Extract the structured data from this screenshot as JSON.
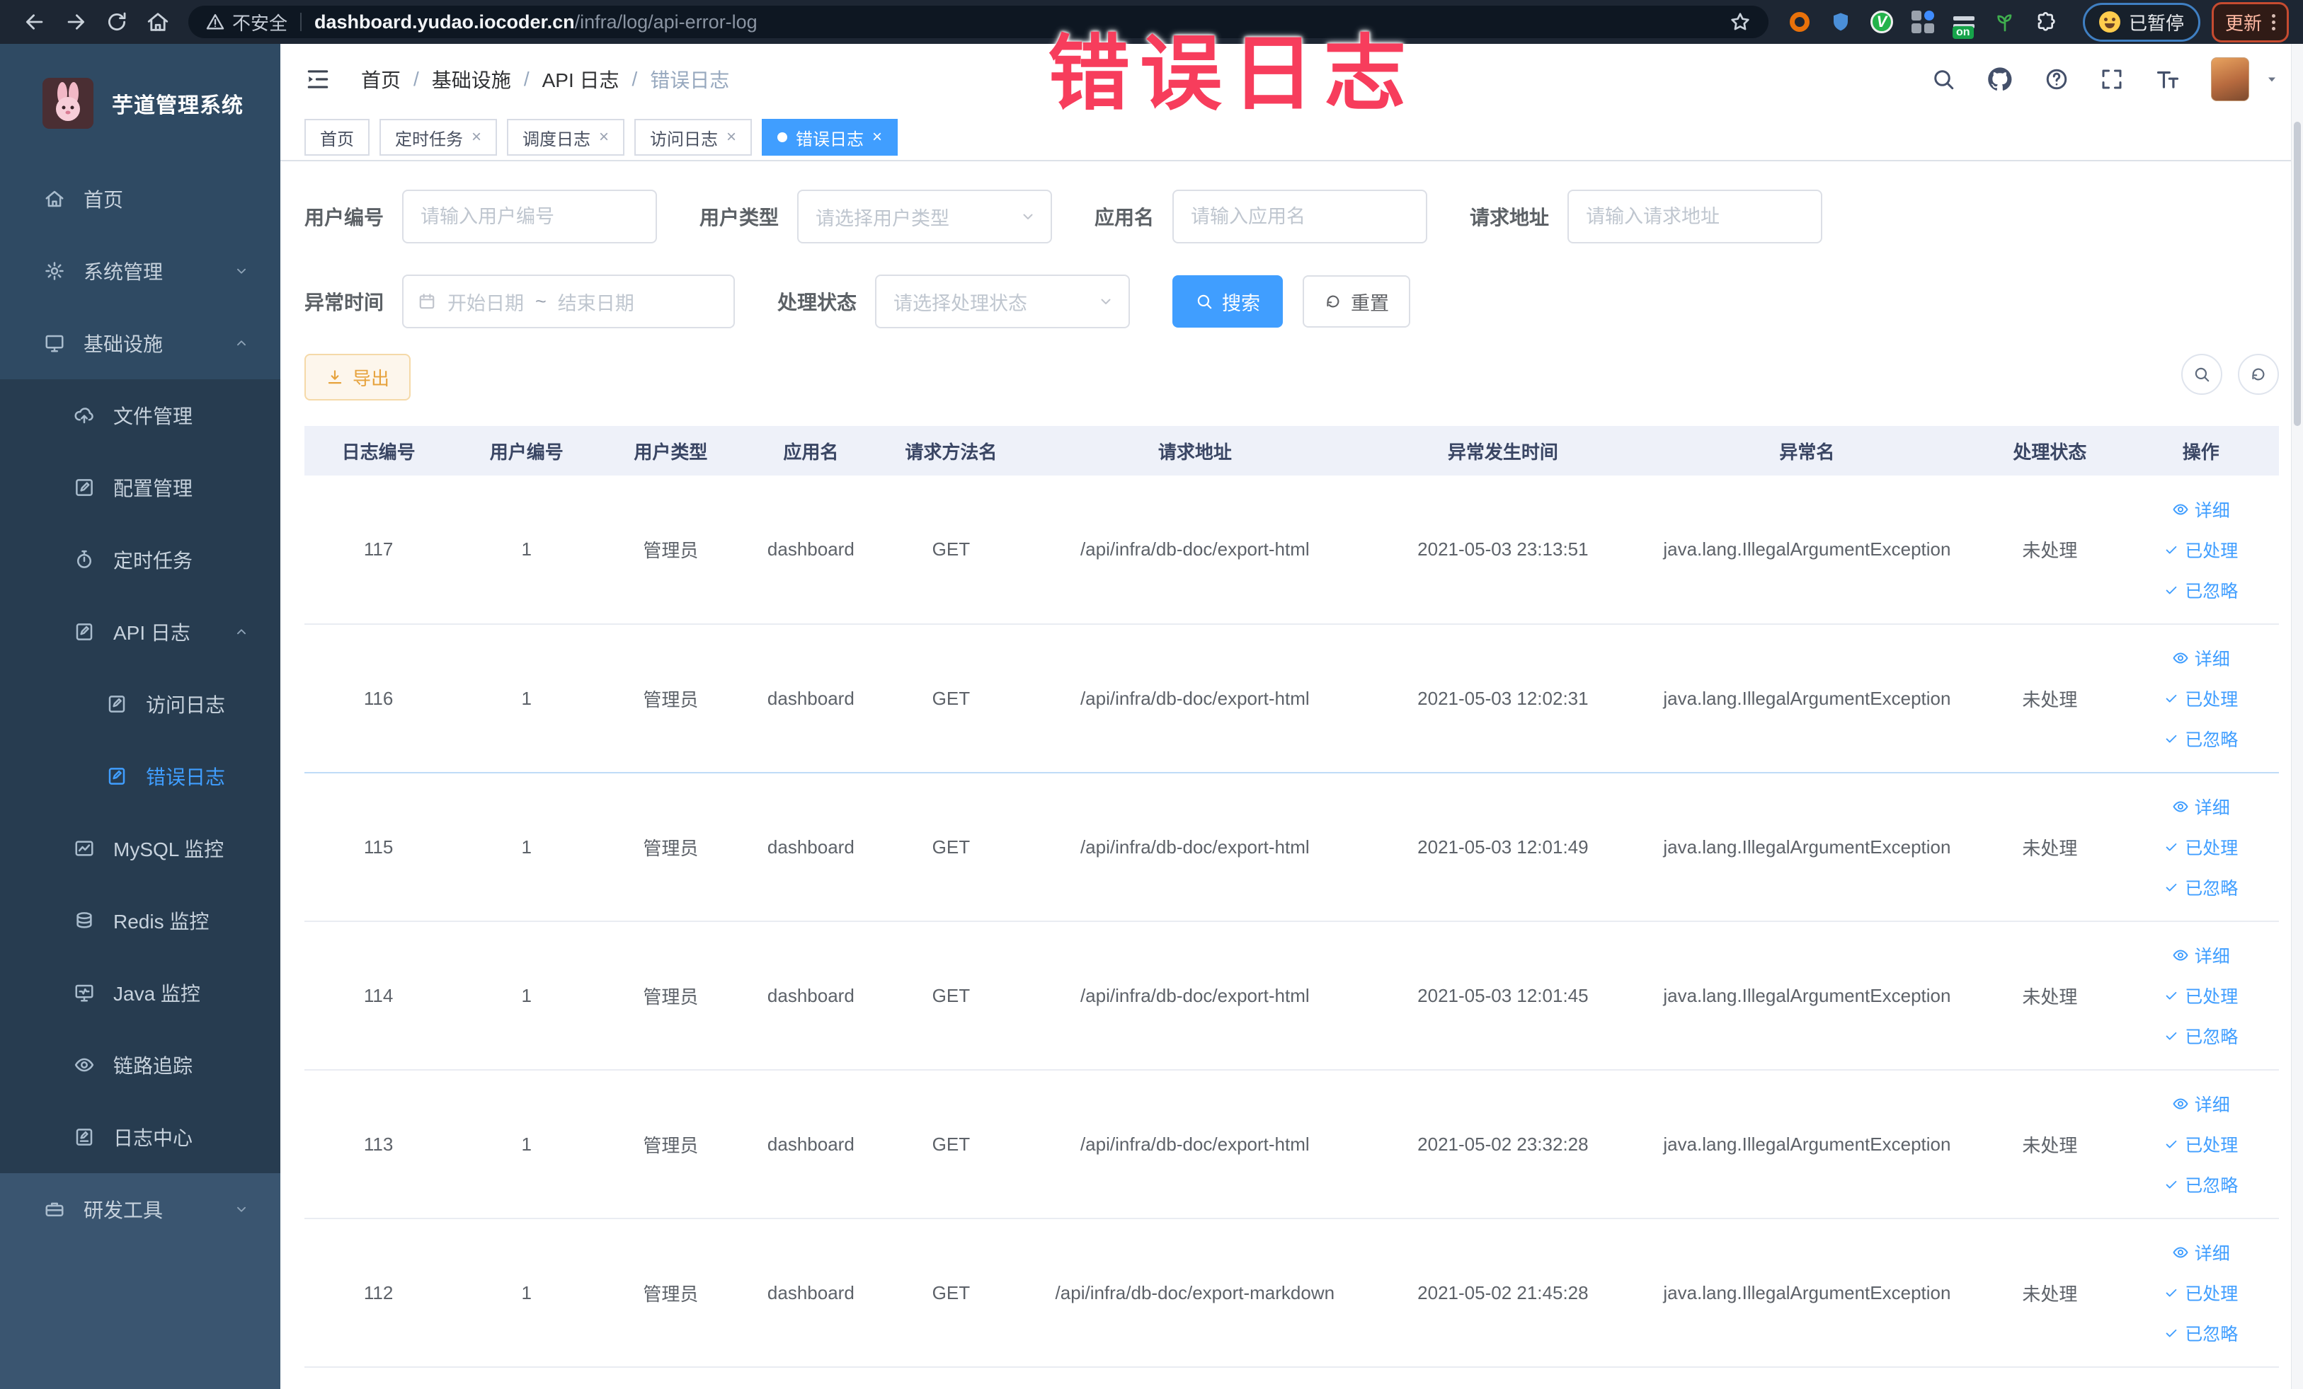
{
  "annotation": {
    "text": "错误日志"
  },
  "browser": {
    "security_label": "不安全",
    "url_host": "dashboard.yudao.iocoder.cn",
    "url_path": "/infra/log/api-error-log",
    "extension_on_badge": "on",
    "paused_pill": "已暂停",
    "update_button": "更新"
  },
  "sidebar": {
    "app_title": "芋道管理系统",
    "items": [
      {
        "label": "首页",
        "icon": "home-icon",
        "level": 1,
        "section": "top"
      },
      {
        "label": "系统管理",
        "icon": "gear-icon",
        "level": 1,
        "section": "top",
        "chevron": "down"
      },
      {
        "label": "基础设施",
        "icon": "monitor-icon",
        "level": 1,
        "section": "top",
        "chevron": "up"
      },
      {
        "label": "文件管理",
        "icon": "cloud-upload-icon",
        "level": 2,
        "section": "sub"
      },
      {
        "label": "配置管理",
        "icon": "edit-square-icon",
        "level": 2,
        "section": "sub"
      },
      {
        "label": "定时任务",
        "icon": "timer-icon",
        "level": 2,
        "section": "sub"
      },
      {
        "label": "API 日志",
        "icon": "api-log-icon",
        "level": 2,
        "section": "sub",
        "chevron": "up"
      },
      {
        "label": "访问日志",
        "icon": "access-log-icon",
        "level": 3,
        "section": "sub"
      },
      {
        "label": "错误日志",
        "icon": "error-log-icon",
        "level": 3,
        "section": "sub",
        "active": true
      },
      {
        "label": "MySQL 监控",
        "icon": "mysql-icon",
        "level": 2,
        "section": "sub"
      },
      {
        "label": "Redis 监控",
        "icon": "redis-icon",
        "level": 2,
        "section": "sub"
      },
      {
        "label": "Java 监控",
        "icon": "java-icon",
        "level": 2,
        "section": "sub"
      },
      {
        "label": "链路追踪",
        "icon": "trace-eye-icon",
        "level": 2,
        "section": "sub"
      },
      {
        "label": "日志中心",
        "icon": "log-center-icon",
        "level": 2,
        "section": "sub"
      },
      {
        "label": "研发工具",
        "icon": "toolbox-icon",
        "level": 1,
        "section": "bottom",
        "chevron": "down"
      }
    ]
  },
  "topbar": {
    "breadcrumb": [
      "首页",
      "基础设施",
      "API 日志",
      "错误日志"
    ]
  },
  "tabs": [
    {
      "label": "首页",
      "closable": false,
      "active": false
    },
    {
      "label": "定时任务",
      "closable": true,
      "active": false
    },
    {
      "label": "调度日志",
      "closable": true,
      "active": false
    },
    {
      "label": "访问日志",
      "closable": true,
      "active": false
    },
    {
      "label": "错误日志",
      "closable": true,
      "active": true
    }
  ],
  "filters": {
    "user_id": {
      "label": "用户编号",
      "placeholder": "请输入用户编号"
    },
    "user_type": {
      "label": "用户类型",
      "placeholder": "请选择用户类型"
    },
    "app_name": {
      "label": "应用名",
      "placeholder": "请输入应用名"
    },
    "request_url": {
      "label": "请求地址",
      "placeholder": "请输入请求地址"
    },
    "exception_time": {
      "label": "异常时间",
      "start_placeholder": "开始日期",
      "separator": "~",
      "end_placeholder": "结束日期"
    },
    "process_status": {
      "label": "处理状态",
      "placeholder": "请选择处理状态"
    },
    "search_button": "搜索",
    "reset_button": "重置"
  },
  "toolbar": {
    "export_button": "导出"
  },
  "table": {
    "columns": [
      "日志编号",
      "用户编号",
      "用户类型",
      "应用名",
      "请求方法名",
      "请求地址",
      "异常发生时间",
      "异常名",
      "处理状态",
      "操作"
    ],
    "action_labels": {
      "detail": "详细",
      "processed": "已处理",
      "ignored": "已忽略"
    },
    "rows": [
      {
        "id": "117",
        "user_id": "1",
        "user_type": "管理员",
        "app": "dashboard",
        "method": "GET",
        "url": "/api/infra/db-doc/export-html",
        "time": "2021-05-03 23:13:51",
        "exception": "java.lang.IllegalArgumentException",
        "status": "未处理"
      },
      {
        "id": "116",
        "user_id": "1",
        "user_type": "管理员",
        "app": "dashboard",
        "method": "GET",
        "url": "/api/infra/db-doc/export-html",
        "time": "2021-05-03 12:02:31",
        "exception": "java.lang.IllegalArgumentException",
        "status": "未处理"
      },
      {
        "id": "115",
        "user_id": "1",
        "user_type": "管理员",
        "app": "dashboard",
        "method": "GET",
        "url": "/api/infra/db-doc/export-html",
        "time": "2021-05-03 12:01:49",
        "exception": "java.lang.IllegalArgumentException",
        "status": "未处理"
      },
      {
        "id": "114",
        "user_id": "1",
        "user_type": "管理员",
        "app": "dashboard",
        "method": "GET",
        "url": "/api/infra/db-doc/export-html",
        "time": "2021-05-03 12:01:45",
        "exception": "java.lang.IllegalArgumentException",
        "status": "未处理"
      },
      {
        "id": "113",
        "user_id": "1",
        "user_type": "管理员",
        "app": "dashboard",
        "method": "GET",
        "url": "/api/infra/db-doc/export-html",
        "time": "2021-05-02 23:32:28",
        "exception": "java.lang.IllegalArgumentException",
        "status": "未处理"
      },
      {
        "id": "112",
        "user_id": "1",
        "user_type": "管理员",
        "app": "dashboard",
        "method": "GET",
        "url": "/api/infra/db-doc/export-markdown",
        "time": "2021-05-02 21:45:28",
        "exception": "java.lang.IllegalArgumentException",
        "status": "未处理"
      }
    ]
  },
  "colors": {
    "accent": "#409EFF",
    "annotation": "#F73D5C",
    "export_accent": "#E6A23C",
    "sidebar_bg": "#2F4A63"
  }
}
